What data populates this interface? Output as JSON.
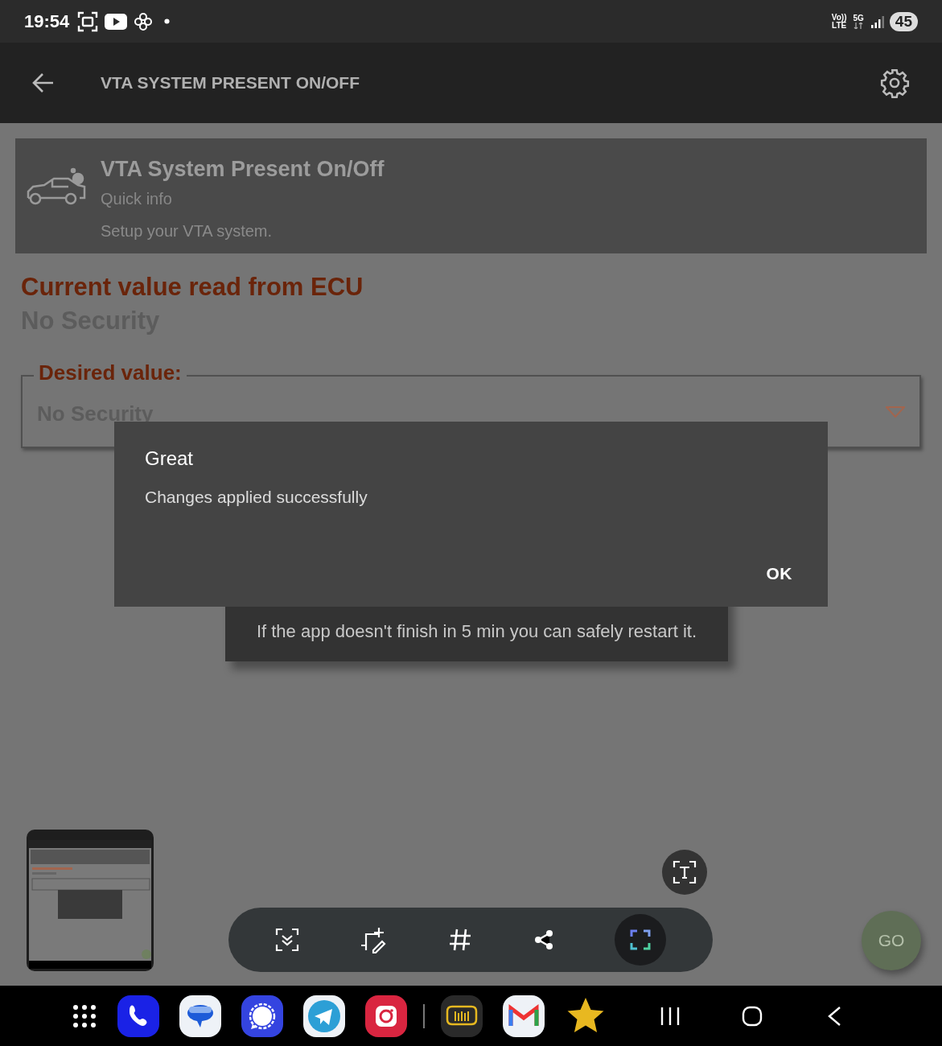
{
  "status_bar": {
    "time": "19:54",
    "volte": "Vo))",
    "lte": "LTE",
    "network": "5G",
    "battery": "45"
  },
  "app_bar": {
    "title": "VTA SYSTEM PRESENT ON/OFF"
  },
  "card": {
    "title": "VTA System Present On/Off",
    "subtitle": "Quick info",
    "description": "Setup your VTA system."
  },
  "current": {
    "label": "Current value read from ECU",
    "value": "No Security"
  },
  "desired": {
    "label": "Desired value:",
    "value": "No Security"
  },
  "progress_toast": {
    "lines": [
      "If the app doesn't finish in 5 min you can safely restart it."
    ]
  },
  "dialog": {
    "title": "Great",
    "message": "Changes applied successfully",
    "button": "OK"
  },
  "fab": {
    "label": "GO"
  }
}
